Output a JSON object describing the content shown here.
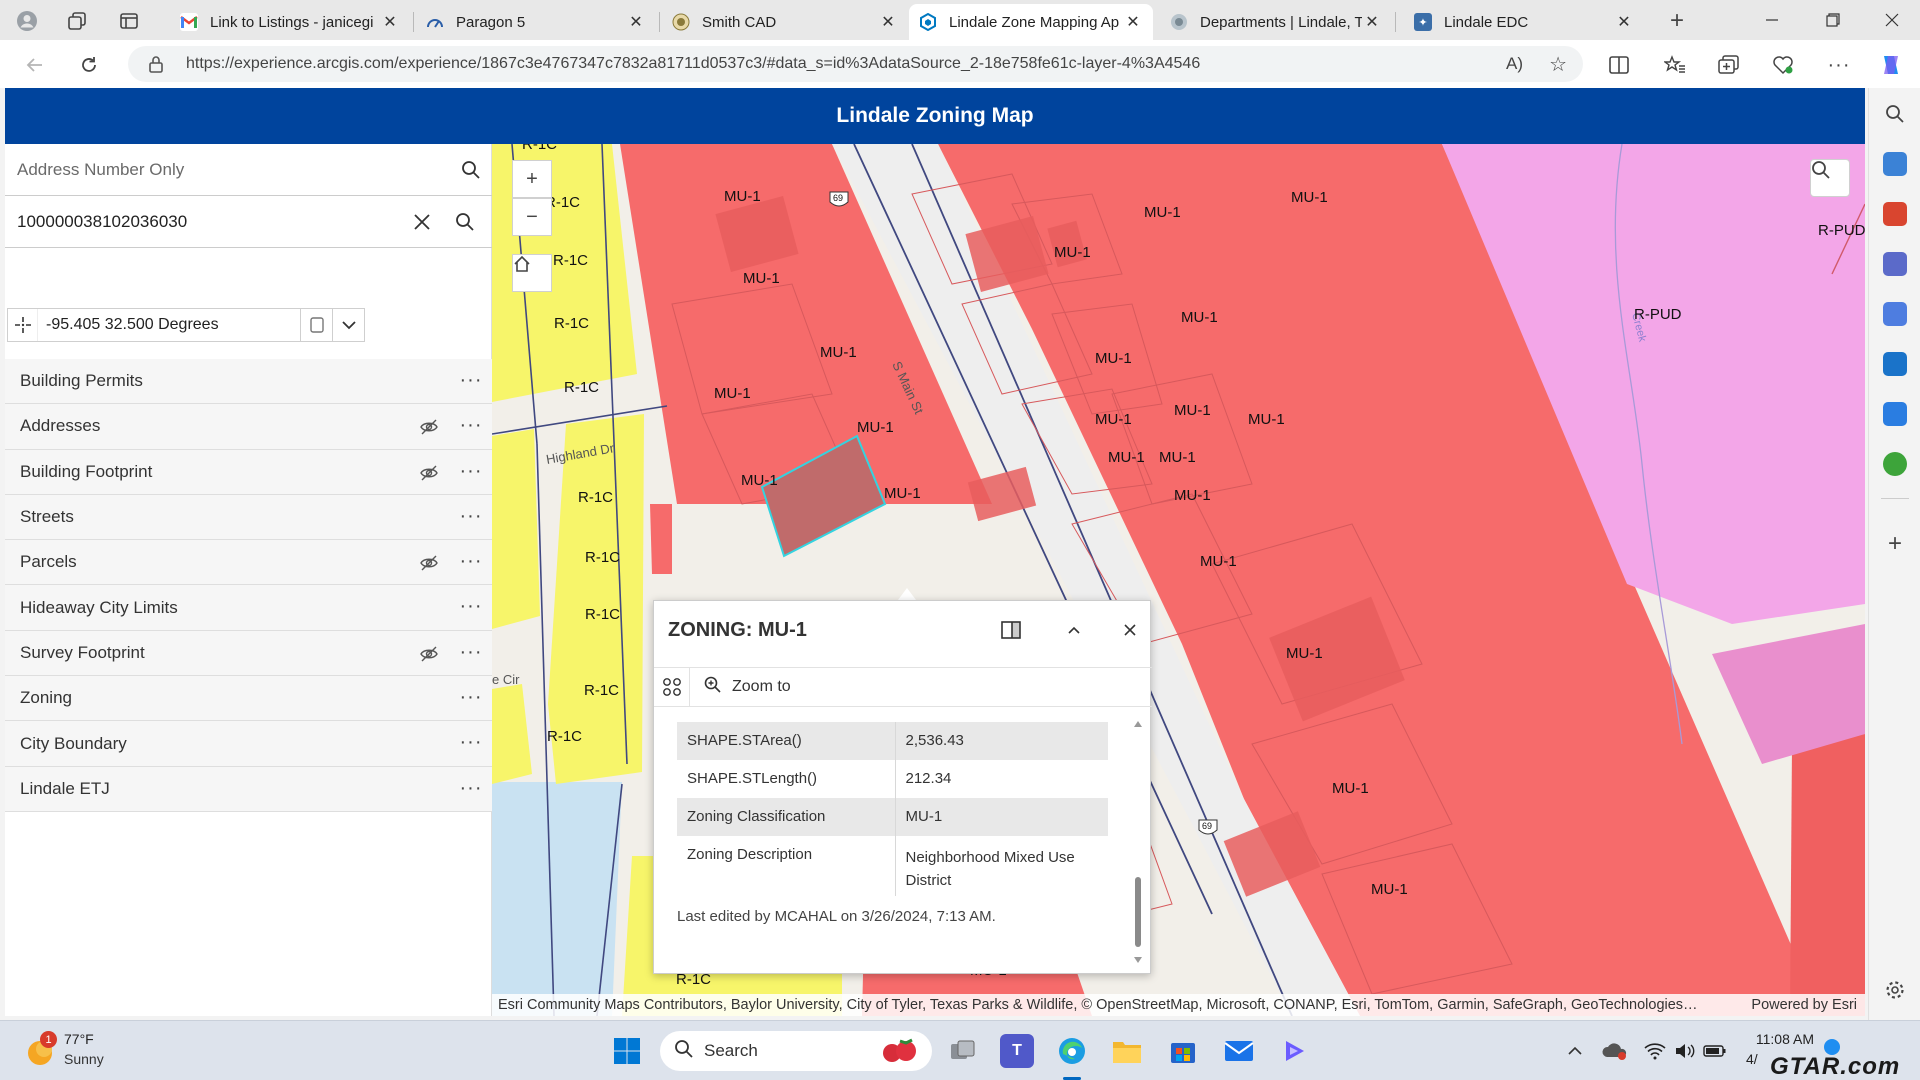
{
  "browser": {
    "tabs": [
      {
        "title": "Link to Listings - janicegi",
        "favicon": "gmail-icon",
        "active": false
      },
      {
        "title": "Paragon 5",
        "favicon": "paragon-icon",
        "active": false
      },
      {
        "title": "Smith CAD",
        "favicon": "smith-cad-icon",
        "active": false
      },
      {
        "title": "Lindale Zone Mapping Ap",
        "favicon": "arcgis-icon",
        "active": true
      },
      {
        "title": "Departments | Lindale, Tx",
        "favicon": "lindale-dept-icon",
        "active": false
      },
      {
        "title": "Lindale EDC",
        "favicon": "lindale-edc-icon",
        "active": false
      }
    ],
    "url": "https://experience.arcgis.com/experience/1867c3e4767347c7832a81711d0537c3/#data_s=id%3AdataSource_2-18e758fe61c-layer-4%3A4546"
  },
  "app": {
    "title": "Lindale Zoning Map",
    "address_search": {
      "placeholder": "Address Number Only"
    },
    "parcel_search": {
      "value": "100000038102036030"
    },
    "coordinates": {
      "value": "-95.405 32.500 Degrees"
    },
    "layers": [
      {
        "label": "Building Permits",
        "hidden": false
      },
      {
        "label": "Addresses",
        "hidden": true
      },
      {
        "label": "Building Footprint",
        "hidden": true
      },
      {
        "label": "Streets",
        "hidden": false
      },
      {
        "label": "Parcels",
        "hidden": true
      },
      {
        "label": "Hideaway City Limits",
        "hidden": false
      },
      {
        "label": "Survey Footprint",
        "hidden": true
      },
      {
        "label": "Zoning",
        "hidden": false
      },
      {
        "label": "City Boundary",
        "hidden": false
      },
      {
        "label": "Lindale ETJ",
        "hidden": false
      }
    ]
  },
  "map": {
    "zone_labels": {
      "mu1": "MU-1",
      "r1c": "R-1C",
      "rpud": "R-PUD"
    },
    "road_labels": {
      "highland": "Highland Dr",
      "main": "S Main St",
      "hwy": "69",
      "cir": "e Cir",
      "creek": "Creek"
    },
    "attribution": "Esri Community Maps Contributors, Baylor University, City of Tyler, Texas Parks & Wildlife, © OpenStreetMap, Microsoft, CONANP, Esri, TomTom, Garmin, SafeGraph, GeoTechnologies…",
    "powered_by": "Powered by Esri",
    "colors": {
      "mu1": "#f66b6b",
      "r1c": "#f7f56a",
      "rpud": "#f3a6e8",
      "header": "#00449d"
    }
  },
  "popup": {
    "title": "ZONING: MU-1",
    "zoom_to": "Zoom to",
    "fields": [
      {
        "key": "SHAPE.STArea()",
        "value": "2,536.43"
      },
      {
        "key": "SHAPE.STLength()",
        "value": "212.34"
      },
      {
        "key": "Zoning Classification",
        "value": "MU-1"
      },
      {
        "key": "Zoning Description",
        "value": "Neighborhood Mixed Use District"
      }
    ],
    "last_edited": "Last edited by MCAHAL on 3/26/2024, 7:13 AM."
  },
  "taskbar": {
    "weather_temp": "77°F",
    "weather_desc": "Sunny",
    "weather_badge": "1",
    "search_placeholder": "Search",
    "time": "11:08 AM",
    "date": "4/",
    "watermark": "GTAR.com"
  }
}
